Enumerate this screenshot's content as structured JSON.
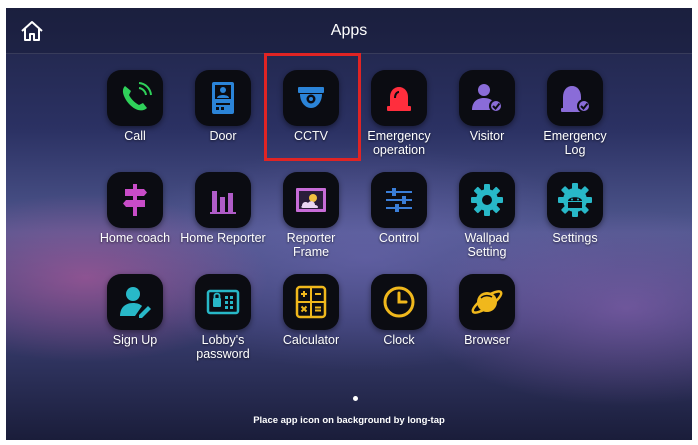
{
  "header": {
    "title": "Apps",
    "home_icon": "home-icon"
  },
  "apps": [
    {
      "label": "Call",
      "icon": "phone-icon",
      "color": "#2fd15a"
    },
    {
      "label": "Door",
      "icon": "door-phone-icon",
      "color": "#2b84d8"
    },
    {
      "label": "CCTV",
      "icon": "cctv-camera-icon",
      "color": "#2b84d8"
    },
    {
      "label": "Emergency operation",
      "icon": "siren-icon",
      "color": "#ff2e3d"
    },
    {
      "label": "Visitor",
      "icon": "visitor-icon",
      "color": "#8a6cd8"
    },
    {
      "label": "Emergency Log",
      "icon": "emergency-log-icon",
      "color": "#8a6cd8"
    },
    {
      "label": "Home coach",
      "icon": "signpost-icon",
      "color": "#c84cc8"
    },
    {
      "label": "Home Reporter",
      "icon": "bar-chart-icon",
      "color": "#b05cc8"
    },
    {
      "label": "Reporter Frame",
      "icon": "weather-frame-icon",
      "color": "#c86cd8"
    },
    {
      "label": "Control",
      "icon": "sliders-icon",
      "color": "#3a7ed8"
    },
    {
      "label": "Wallpad Setting",
      "icon": "gear-icon",
      "color": "#28b8c8"
    },
    {
      "label": "Settings",
      "icon": "android-gear-icon",
      "color": "#28b8c8"
    },
    {
      "label": "Sign Up",
      "icon": "user-edit-icon",
      "color": "#28b8c8"
    },
    {
      "label": "Lobby's password",
      "icon": "keypad-lock-icon",
      "color": "#28b8c8"
    },
    {
      "label": "Calculator",
      "icon": "calculator-icon",
      "color": "#f0b81c"
    },
    {
      "label": "Clock",
      "icon": "clock-icon",
      "color": "#f0b81c"
    },
    {
      "label": "Browser",
      "icon": "planet-browser-icon",
      "color": "#f0b81c"
    }
  ],
  "highlighted_app": "CCTV",
  "page_indicator": {
    "current": 1,
    "total": 1
  },
  "hint": "Place app icon on background by long-tap"
}
